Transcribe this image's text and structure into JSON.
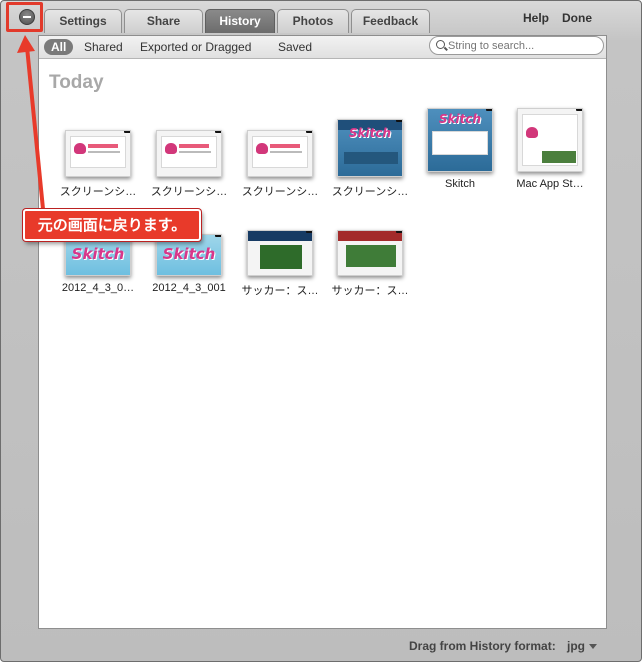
{
  "tabs": [
    {
      "label": "Settings",
      "active": false
    },
    {
      "label": "Share",
      "active": false
    },
    {
      "label": "History",
      "active": true
    },
    {
      "label": "Photos",
      "active": false
    },
    {
      "label": "Feedback",
      "active": false
    }
  ],
  "top_actions": {
    "help": "Help",
    "done": "Done"
  },
  "filters": [
    {
      "label": "All",
      "active": true
    },
    {
      "label": "Shared",
      "active": false
    },
    {
      "label": "Exported or Dragged",
      "active": false
    },
    {
      "label": "Saved",
      "active": false
    }
  ],
  "search": {
    "placeholder": "String to search..."
  },
  "section": {
    "title": "Today"
  },
  "items": [
    {
      "label": "スクリーンシ…",
      "kind": "screenshot-heart"
    },
    {
      "label": "スクリーンシ…",
      "kind": "screenshot-heart"
    },
    {
      "label": "スクリーンシ…",
      "kind": "screenshot-heart"
    },
    {
      "label": "スクリーンシ…",
      "kind": "screenshot-blue"
    },
    {
      "label": "Skitch",
      "kind": "skitch-web"
    },
    {
      "label": "Mac App St…",
      "kind": "appstore"
    },
    {
      "label": "2012_4_3_0…",
      "kind": "skitch-logo"
    },
    {
      "label": "2012_4_3_001",
      "kind": "skitch-logo"
    },
    {
      "label": "サッカー：ス…",
      "kind": "soccer"
    },
    {
      "label": "サッカー：ス…",
      "kind": "soccer"
    }
  ],
  "callout": {
    "text": "元の画面に戻ります。"
  },
  "footer": {
    "label": "Drag from History format:",
    "format": "jpg"
  },
  "colors": {
    "annotation": "#e83a2a",
    "active_tab": "#7a7a7a",
    "section_title": "#a8a8a8"
  }
}
